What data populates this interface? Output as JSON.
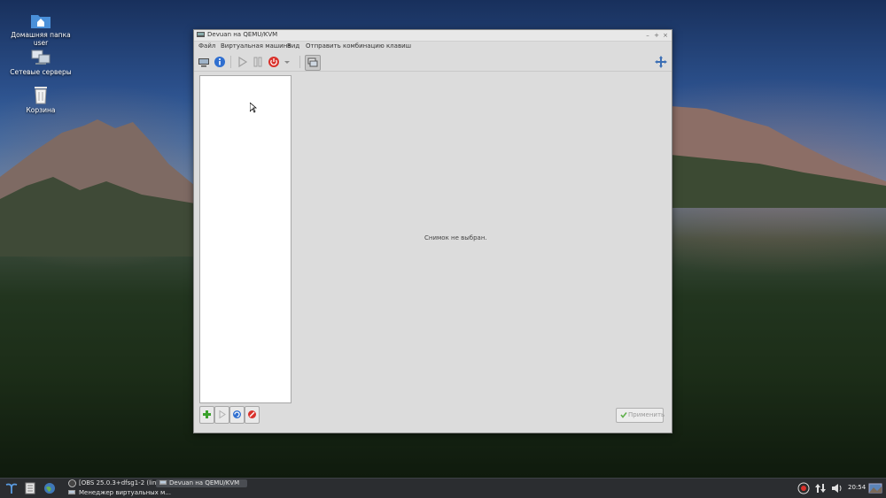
{
  "desktop": {
    "icons": [
      {
        "label": "Домашняя папка user",
        "icon": "home-folder-icon"
      },
      {
        "label": "Сетевые серверы",
        "icon": "network-servers-icon"
      },
      {
        "label": "Корзина",
        "icon": "trash-icon"
      }
    ]
  },
  "window": {
    "title": "Devuan на QEMU/KVM",
    "controls": {
      "minimize": "–",
      "maximize": "+",
      "close": "×"
    },
    "menu": [
      "Файл",
      "Виртуальная машина",
      "Вид",
      "Отправить комбинацию клавиш"
    ],
    "snapshots": {
      "empty_message": "Снимок не выбран.",
      "apply_label": "Применить"
    }
  },
  "taskbar": {
    "tasks": [
      {
        "label": "[OBS 25.0.3+dfsg1-2 (linux) - ..."
      },
      {
        "label": "Devuan на QEMU/KVM",
        "active": true
      },
      {
        "label": "Менеджер виртуальных м..."
      }
    ],
    "clock": "20:54"
  },
  "colors": {
    "power_red": "#d9312b",
    "info_blue": "#2f6fd0",
    "add_green": "#3aa12c"
  }
}
